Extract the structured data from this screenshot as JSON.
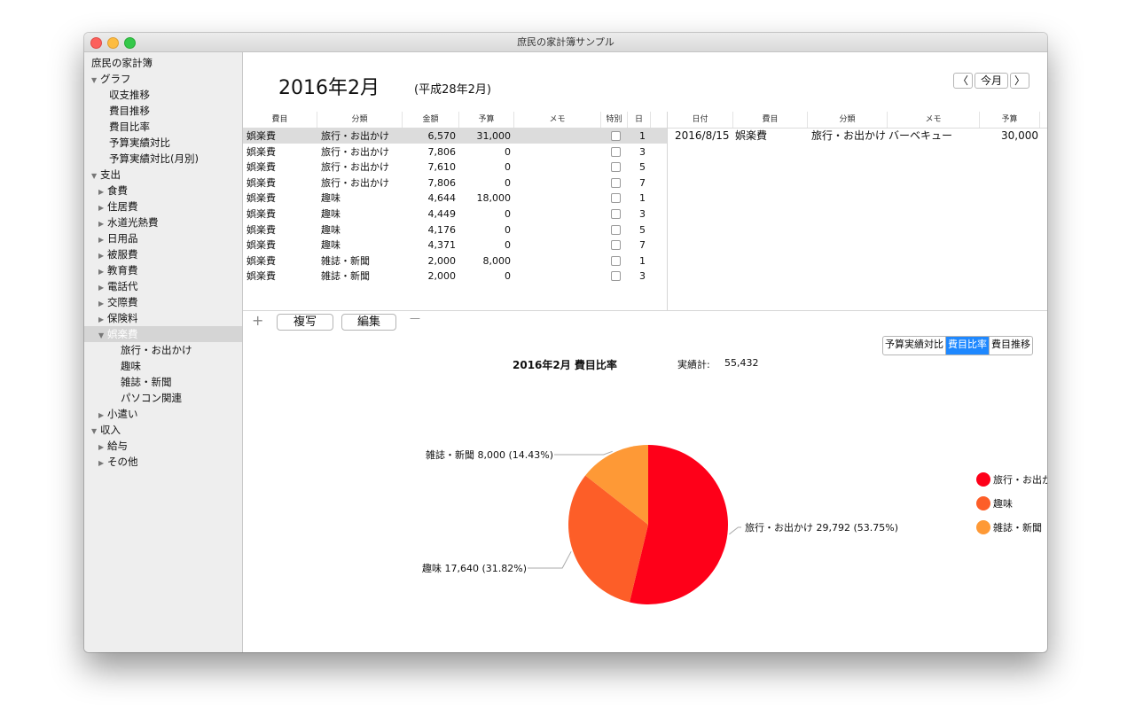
{
  "window": {
    "title": "庶民の家計簿サンプル"
  },
  "sidebar": {
    "items": [
      {
        "label": "庶民の家計簿",
        "level": 0,
        "tri": ""
      },
      {
        "label": "グラフ",
        "level": 0,
        "tri": "▼"
      },
      {
        "label": "収支推移",
        "level": 1,
        "tri": ""
      },
      {
        "label": "費目推移",
        "level": 1,
        "tri": ""
      },
      {
        "label": "費目比率",
        "level": 1,
        "tri": ""
      },
      {
        "label": "予算実績対比",
        "level": 1,
        "tri": ""
      },
      {
        "label": "予算実績対比(月別)",
        "level": 1,
        "tri": ""
      },
      {
        "label": "支出",
        "level": 0,
        "tri": "▼"
      },
      {
        "label": "食費",
        "level": 1,
        "tri": "▶"
      },
      {
        "label": "住居費",
        "level": 1,
        "tri": "▶"
      },
      {
        "label": "水道光熱費",
        "level": 1,
        "tri": "▶"
      },
      {
        "label": "日用品",
        "level": 1,
        "tri": "▶"
      },
      {
        "label": "被服費",
        "level": 1,
        "tri": "▶"
      },
      {
        "label": "教育費",
        "level": 1,
        "tri": "▶"
      },
      {
        "label": "電話代",
        "level": 1,
        "tri": "▶"
      },
      {
        "label": "交際費",
        "level": 1,
        "tri": "▶"
      },
      {
        "label": "保険料",
        "level": 1,
        "tri": "▶"
      },
      {
        "label": "娯楽費",
        "level": 1,
        "tri": "▼",
        "selected": true
      },
      {
        "label": "旅行・お出かけ",
        "level": 2,
        "tri": ""
      },
      {
        "label": "趣味",
        "level": 2,
        "tri": ""
      },
      {
        "label": "雑誌・新聞",
        "level": 2,
        "tri": ""
      },
      {
        "label": "パソコン関連",
        "level": 2,
        "tri": ""
      },
      {
        "label": "小遣い",
        "level": 1,
        "tri": "▶"
      },
      {
        "label": "収入",
        "level": 0,
        "tri": "▼"
      },
      {
        "label": "給与",
        "level": 1,
        "tri": "▶"
      },
      {
        "label": "その他",
        "level": 1,
        "tri": "▶"
      }
    ]
  },
  "header": {
    "month": "2016年2月",
    "era": "(平成28年2月)",
    "prev": "〈",
    "today": "今月",
    "next": "〉"
  },
  "table": {
    "columns": [
      "費目",
      "分類",
      "金額",
      "予算",
      "メモ",
      "特別",
      "日"
    ],
    "rows": [
      [
        "娯楽費",
        "旅行・お出かけ",
        "6,570",
        "31,000",
        "",
        "",
        "1"
      ],
      [
        "娯楽費",
        "旅行・お出かけ",
        "7,806",
        "0",
        "",
        "",
        "3"
      ],
      [
        "娯楽費",
        "旅行・お出かけ",
        "7,610",
        "0",
        "",
        "",
        "5"
      ],
      [
        "娯楽費",
        "旅行・お出かけ",
        "7,806",
        "0",
        "",
        "",
        "7"
      ],
      [
        "娯楽費",
        "趣味",
        "4,644",
        "18,000",
        "",
        "",
        "1"
      ],
      [
        "娯楽費",
        "趣味",
        "4,449",
        "0",
        "",
        "",
        "3"
      ],
      [
        "娯楽費",
        "趣味",
        "4,176",
        "0",
        "",
        "",
        "5"
      ],
      [
        "娯楽費",
        "趣味",
        "4,371",
        "0",
        "",
        "",
        "7"
      ],
      [
        "娯楽費",
        "雑誌・新聞",
        "2,000",
        "8,000",
        "",
        "",
        "1"
      ],
      [
        "娯楽費",
        "雑誌・新聞",
        "2,000",
        "0",
        "",
        "",
        "3"
      ]
    ],
    "plus": "+",
    "minus": "—",
    "copy_label": "複写",
    "edit_label": "編集"
  },
  "table2": {
    "columns": [
      "日付",
      "費目",
      "分類",
      "メモ",
      "予算"
    ],
    "rows": [
      [
        "2016/8/15",
        "娯楽費",
        "旅行・お出かけ",
        "バーベキュー",
        "30,000"
      ]
    ]
  },
  "chart_section": {
    "title": "2016年2月 費目比率",
    "total_label": "実績計:",
    "total_value": "55,432",
    "tabs": [
      "予算実績対比",
      "費目比率",
      "費目推移"
    ],
    "active_tab": 1
  },
  "chart_data": {
    "type": "pie",
    "title": "2016年2月 費目比率",
    "slices": [
      {
        "name": "旅行・お出かけ",
        "value": 29792,
        "value_label": "29,792",
        "label": "旅行・お出かけ 29,792 (53.75%)",
        "color": "#fe0019"
      },
      {
        "name": "趣味",
        "value": 17640,
        "value_label": "17,640",
        "label": "趣味 17,640 (31.82%)",
        "color": "#fd5e28"
      },
      {
        "name": "雑誌・新聞",
        "value": 8000,
        "value_label": "8,000",
        "label": "雑誌・新聞 8,000 (14.43%)",
        "color": "#fe9936"
      }
    ],
    "start_angle_deg": 0,
    "direction": "clockwise",
    "legend_position": "right"
  }
}
